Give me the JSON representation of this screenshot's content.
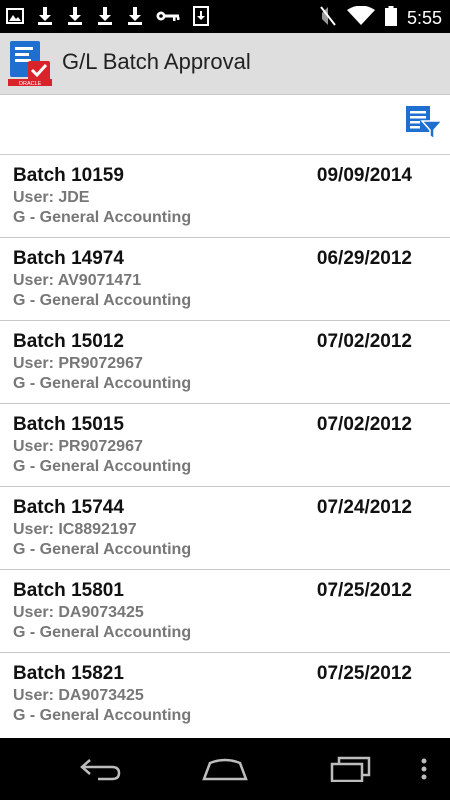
{
  "status_bar": {
    "time": "5:55",
    "icons": [
      "image-icon",
      "download-icon",
      "download-icon",
      "download-icon",
      "download-icon",
      "key-icon",
      "sd-download-icon",
      "mute-icon",
      "wifi-icon",
      "battery-icon"
    ]
  },
  "app_bar": {
    "title": "G/L Batch Approval",
    "logo_text": "ORACLE"
  },
  "toolbar": {
    "filter_icon": "filter-list-icon"
  },
  "batches": [
    {
      "title": "Batch 10159",
      "date": "09/09/2014",
      "user": "User: JDE",
      "ledger": "G - General Accounting"
    },
    {
      "title": "Batch 14974",
      "date": "06/29/2012",
      "user": "User: AV9071471",
      "ledger": "G - General Accounting"
    },
    {
      "title": "Batch 15012",
      "date": "07/02/2012",
      "user": "User: PR9072967",
      "ledger": "G - General Accounting"
    },
    {
      "title": "Batch 15015",
      "date": "07/02/2012",
      "user": "User: PR9072967",
      "ledger": "G - General Accounting"
    },
    {
      "title": "Batch 15744",
      "date": "07/24/2012",
      "user": "User: IC8892197",
      "ledger": "G - General Accounting"
    },
    {
      "title": "Batch 15801",
      "date": "07/25/2012",
      "user": "User: DA9073425",
      "ledger": "G - General Accounting"
    },
    {
      "title": "Batch 15821",
      "date": "07/25/2012",
      "user": "User: DA9073425",
      "ledger": "G - General Accounting"
    }
  ],
  "nav_bar": {
    "buttons": [
      "back-icon",
      "home-icon",
      "recents-icon",
      "overflow-menu-icon"
    ]
  },
  "colors": {
    "accent": "#1e6fd0",
    "app_bar_bg": "#dedede",
    "secondary_text": "#777777",
    "logo_red": "#d9232a"
  }
}
